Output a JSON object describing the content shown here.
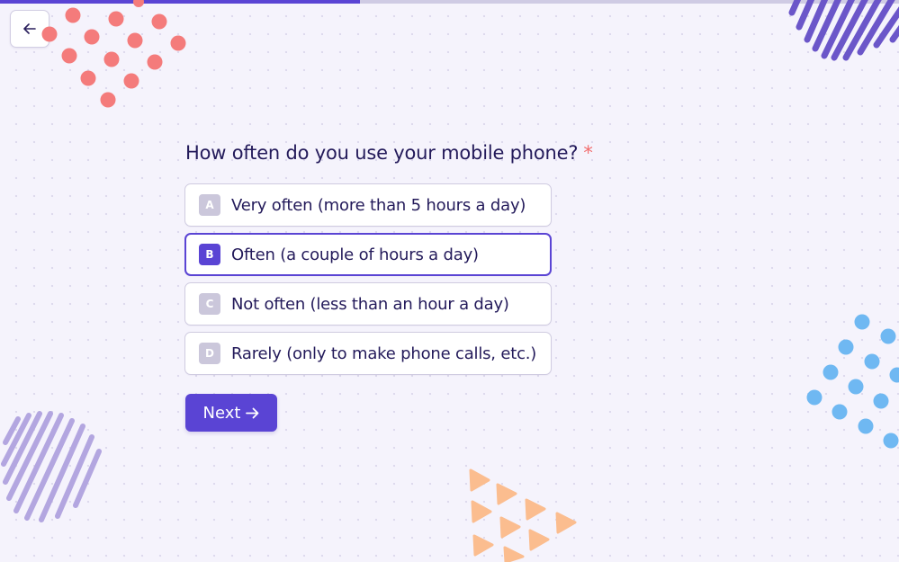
{
  "progress": {
    "fraction": 0.4
  },
  "question": {
    "text": "How often do you use your mobile phone?",
    "required_marker": "*"
  },
  "options": [
    {
      "key": "A",
      "label": "Very often (more than 5 hours a day)",
      "selected": false
    },
    {
      "key": "B",
      "label": "Often (a couple of hours a day)",
      "selected": true
    },
    {
      "key": "C",
      "label": "Not often (less than an hour a day)",
      "selected": false
    },
    {
      "key": "D",
      "label": "Rarely (only to make phone calls, etc.)",
      "selected": false
    }
  ],
  "next_button": {
    "label": "Next",
    "icon": "arrow-right-icon"
  },
  "back_button": {
    "icon": "arrow-left-icon"
  },
  "colors": {
    "accent": "#5a44d4",
    "background": "#f5f3fc",
    "required": "#f26d6d",
    "decor_red": "#f47b7b",
    "decor_blue": "#6fb8f2",
    "decor_orange": "#fbbd8f",
    "decor_purple": "#6b56c9",
    "decor_lavender": "#b3a6e0"
  }
}
